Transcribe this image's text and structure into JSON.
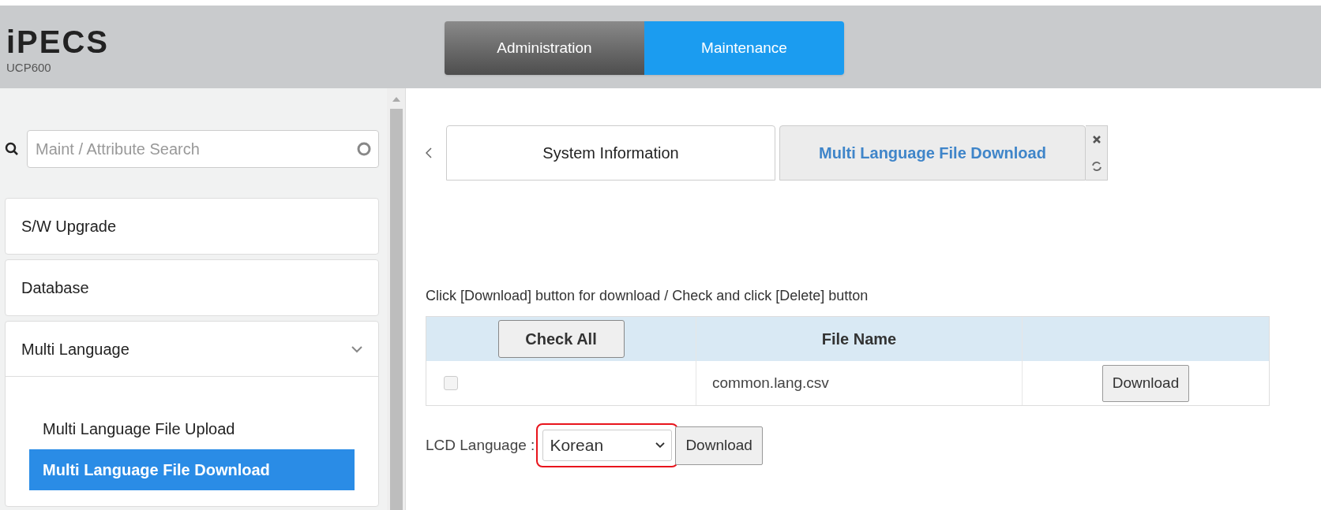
{
  "header": {
    "logo": "iPECS",
    "model": "UCP600",
    "nav": [
      {
        "label": "Administration",
        "selected": false
      },
      {
        "label": "Maintenance",
        "selected": true
      }
    ]
  },
  "sidebar": {
    "search": {
      "placeholder": "Maint / Attribute Search"
    },
    "items": [
      {
        "label": "S/W Upgrade",
        "expanded": false
      },
      {
        "label": "Database",
        "expanded": false
      },
      {
        "label": "Multi Language",
        "expanded": true,
        "children": [
          {
            "label": "Multi Language File Upload",
            "selected": false
          },
          {
            "label": "Multi Language File Download",
            "selected": true
          }
        ]
      }
    ]
  },
  "tabs": [
    {
      "label": "System Information",
      "selected": false
    },
    {
      "label": "Multi Language File Download",
      "selected": true
    }
  ],
  "instruction": "Click [Download] button for download / Check and click [Delete] button",
  "table": {
    "check_all": "Check All",
    "columns": [
      "File Name"
    ],
    "rows": [
      {
        "checked": false,
        "file_name": "common.lang.csv",
        "button": "Download"
      }
    ]
  },
  "lcd_language": {
    "label": "LCD Language :",
    "value": "Korean",
    "highlighted": true,
    "button": "Download"
  }
}
